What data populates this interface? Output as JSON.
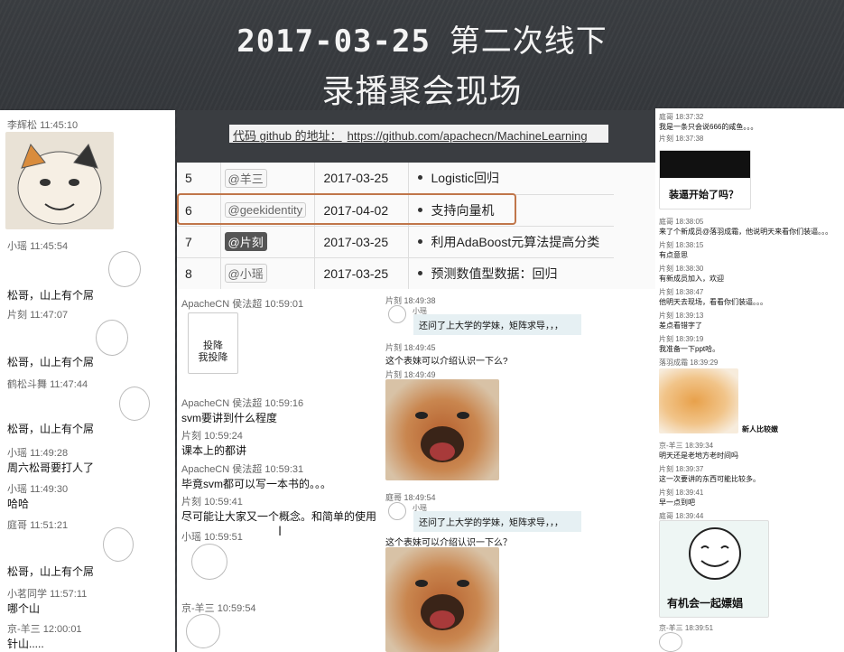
{
  "title": {
    "line1_date": "2017-03-25",
    "line1_rest": "第二次线下",
    "line2": "录播聚会现场"
  },
  "repo": {
    "label": "代码 github 的地址：",
    "url": "https://github.com/apachecn/MachineLearning"
  },
  "schedule": [
    {
      "num": "5",
      "who": "@羊三",
      "date": "2017-03-25",
      "topic": "Logistic回归"
    },
    {
      "num": "6",
      "who": "@geekidentity",
      "date": "2017-04-02",
      "topic": "支持向量机"
    },
    {
      "num": "7",
      "who": "@片刻",
      "date": "2017-03-25",
      "topic": "利用AdaBoost元算法提高分类"
    },
    {
      "num": "8",
      "who": "@小瑶",
      "date": "2017-03-25",
      "topic": "预测数值型数据：回归"
    }
  ],
  "left_chat": [
    {
      "sender": "李辉松",
      "time": "11:45:10"
    },
    {
      "sender": "小瑶",
      "time": "11:45:54",
      "text": "松哥，山上有个屌"
    },
    {
      "sender": "片刻",
      "time": "11:47:07",
      "text": "松哥，山上有个屌"
    },
    {
      "sender": "鹤松斗舞",
      "time": "11:47:44",
      "text": "松哥，山上有个屌"
    },
    {
      "sender": "小瑶",
      "time": "11:49:28",
      "text": "周六松哥要打人了"
    },
    {
      "sender": "小瑶",
      "time": "11:49:30",
      "text": "哈哈"
    },
    {
      "sender": "庭哥",
      "time": "11:51:21",
      "text": "松哥，山上有个屌"
    },
    {
      "sender": "小茗同学",
      "time": "11:57:11",
      "text": "哪个山"
    },
    {
      "sender": "京-羊三",
      "time": "12:00:01",
      "text": "针山....."
    }
  ],
  "mid_chat": [
    {
      "sender": "ApacheCN  侯法超",
      "time": "10:59:01",
      "sticker": "投降\n我投降"
    },
    {
      "sender": "ApacheCN  侯法超",
      "time": "10:59:16",
      "text": "svm要讲到什么程度"
    },
    {
      "sender": "片刻",
      "time": "10:59:24",
      "text": "课本上的都讲"
    },
    {
      "sender": "ApacheCN  侯法超",
      "time": "10:59:31",
      "text": "毕竟svm都可以写一本书的。。。"
    },
    {
      "sender": "片刻",
      "time": "10:59:41",
      "text": "尽可能让大家又一个概念。和简单的使用"
    },
    {
      "sender": "小瑶",
      "time": "10:59:51"
    },
    {
      "sender": "京-羊三",
      "time": "10:59:54"
    }
  ],
  "mid_chat2": [
    {
      "sender": "片刻",
      "time": "18:49:38",
      "sub": "小瑶",
      "bubble": "还问了上大学的学妹，矩阵求导，，，"
    },
    {
      "sender": "片刻",
      "time": "18:49:45",
      "text": "这个表妹可以介绍认识一下么?"
    },
    {
      "sender": "片刻",
      "time": "18:49:49"
    },
    {
      "sender": "庭哥",
      "time": "18:49:54",
      "sub": "小瑶",
      "bubble": "还问了上大学的学妹，矩阵求导，，，",
      "text": "这个表妹可以介绍认识一下么？"
    }
  ],
  "right_chat": [
    {
      "sender": "庭哥",
      "time": "18:37:32",
      "text": "我是一条只会说666的咸鱼。。。"
    },
    {
      "sender": "片刻",
      "time": "18:37:38",
      "caption": "装逼开始了吗？"
    },
    {
      "sender": "庭哥",
      "time": "18:38:05",
      "text": "来了个新成员@落羽成霜，他说明天来看你们装逼。。。"
    },
    {
      "sender": "片刻",
      "time": "18:38:15",
      "text": "有点意思"
    },
    {
      "sender": "片刻",
      "time": "18:38:30",
      "text": "有新成员加入，欢迎"
    },
    {
      "sender": "片刻",
      "time": "18:38:47",
      "text": "他明天去现场，看看你们装逼。。。"
    },
    {
      "sender": "片刻",
      "time": "18:39:13",
      "text": "差点看错字了"
    },
    {
      "sender": "片刻",
      "time": "18:39:19",
      "text": "我准备一下ppt哈。"
    },
    {
      "sender": "落羽成霜",
      "time": "18:39:29",
      "caption": "新人比较嫩"
    },
    {
      "sender": "京-羊三",
      "time": "18:39:34",
      "text": "明天还是老地方老时间吗"
    },
    {
      "sender": "片刻",
      "time": "18:39:37",
      "text": "这一次要讲的东西可能比较多。"
    },
    {
      "sender": "片刻",
      "time": "18:39:41",
      "text": "早一点到吧"
    },
    {
      "sender": "庭哥",
      "time": "18:39:44",
      "caption": "有机会一起嫖娼"
    },
    {
      "sender": "京-羊三",
      "time": "18:39:51"
    }
  ],
  "colors": {
    "board": "#34373b",
    "highlight": "#c0764a",
    "bubble": "#e6f0f3",
    "chalk": "#f4f4f4"
  },
  "icons": [
    "text-cursor-icon"
  ]
}
